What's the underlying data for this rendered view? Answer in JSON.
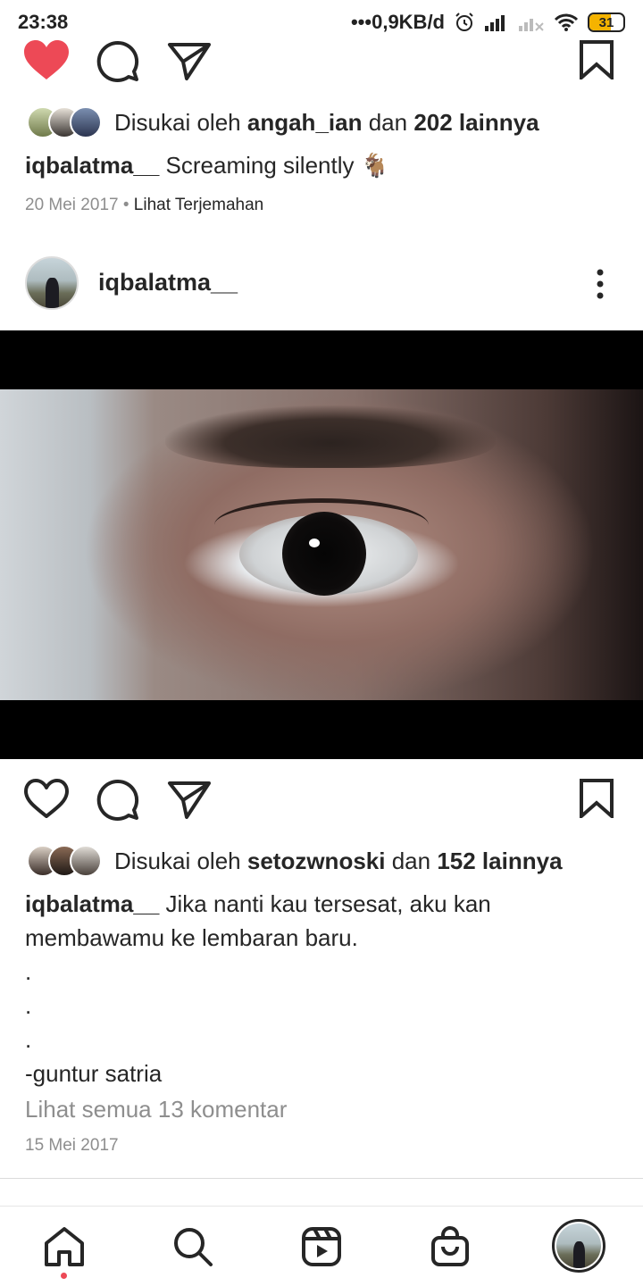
{
  "status_bar": {
    "time": "23:38",
    "network_speed": "•••0,9KB/d",
    "battery": "31"
  },
  "post1": {
    "liked": true,
    "likes_prefix": "Disukai oleh",
    "likes_user": "angah_ian",
    "likes_mid": "dan",
    "likes_count": "202 lainnya",
    "caption_user": "iqbalatma__",
    "caption_text": "Screaming silently 🐐",
    "date": "20 Mei 2017",
    "separator": "•",
    "translate_label": "Lihat Terjemahan"
  },
  "post2": {
    "username": "iqbalatma__",
    "liked": false,
    "likes_prefix": "Disukai oleh",
    "likes_user": "setozwnoski",
    "likes_mid": "dan",
    "likes_count": "152 lainnya",
    "caption_user": "iqbalatma__",
    "caption_line1": "Jika nanti kau tersesat, aku kan",
    "caption_line2": "membawamu ke lembaran baru.",
    "dot1": ".",
    "dot2": ".",
    "dot3": ".",
    "caption_line3": "-guntur satria",
    "view_comments": "Lihat semua 13 komentar",
    "date": "15 Mei 2017"
  },
  "nav": {
    "items": [
      "home-icon",
      "search-icon",
      "reels-icon",
      "shop-icon",
      "profile-avatar"
    ],
    "active": "home-icon"
  },
  "colors": {
    "like_red": "#ed4956",
    "text": "#262626",
    "muted": "#8e8e8e"
  }
}
